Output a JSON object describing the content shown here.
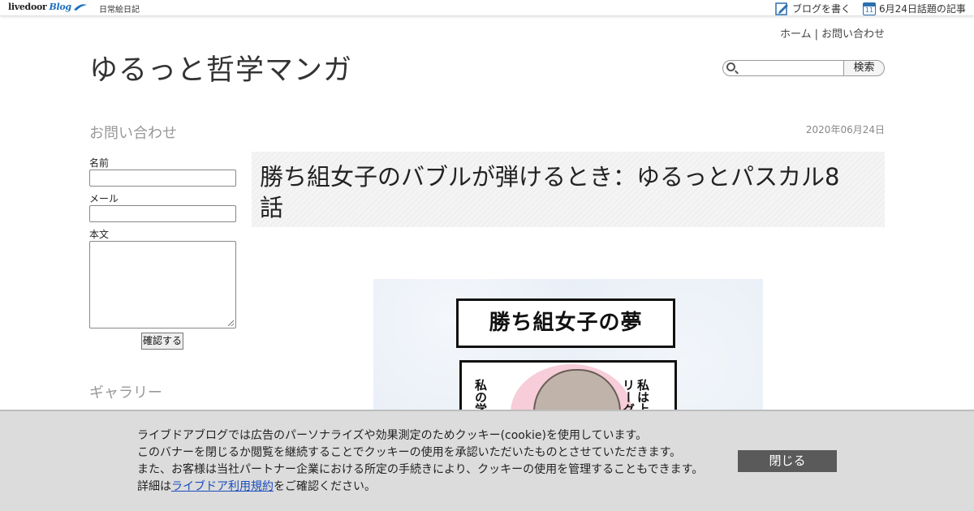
{
  "topbar": {
    "logo_text": "livedoor",
    "logo_blog": "Blog",
    "blog_sub": "日常絵日記",
    "write_label": "ブログを書く",
    "calendar_day": "11",
    "today_label": "6月24日話題の記事"
  },
  "header": {
    "links": [
      "ホーム",
      "お問い合わせ"
    ],
    "site_title": "ゆるっと哲学マンガ",
    "search_placeholder": "",
    "search_button": "検索"
  },
  "sidebar": {
    "contact_heading": "お問い合わせ",
    "name_label": "名前",
    "mail_label": "メール",
    "body_label": "本文",
    "confirm_button": "確認する",
    "gallery_heading": "ギャラリー"
  },
  "article": {
    "date": "2020年06月24日",
    "title": "勝ち組女子のバブルが弾けるとき：ゆるっとパスカル8話",
    "manga_title": "勝ち組女子の夢",
    "manga_left_text": "私の学校",
    "manga_right_text": "私は上位リーグ"
  },
  "cookie": {
    "line1": "ライブドアブログでは広告のパーソナライズや効果測定のためクッキー(cookie)を使用しています。",
    "line2": "このバナーを閉じるか閲覧を継続することでクッキーの使用を承認いただいたものとさせていただきます。",
    "line3": "また、お客様は当社パートナー企業における所定の手続きにより、クッキーの使用を管理することもできます。",
    "line4_prefix": "詳細は",
    "line4_link": "ライブドア利用規約",
    "line4_suffix": "をご確認ください。",
    "close_button": "閉じる"
  },
  "colors": {
    "logo_blue": "#1a6fc0",
    "link_blue": "#1a4dbd",
    "close_button_bg": "#5a5a5a",
    "banner_bg": "#dcdcdc"
  }
}
